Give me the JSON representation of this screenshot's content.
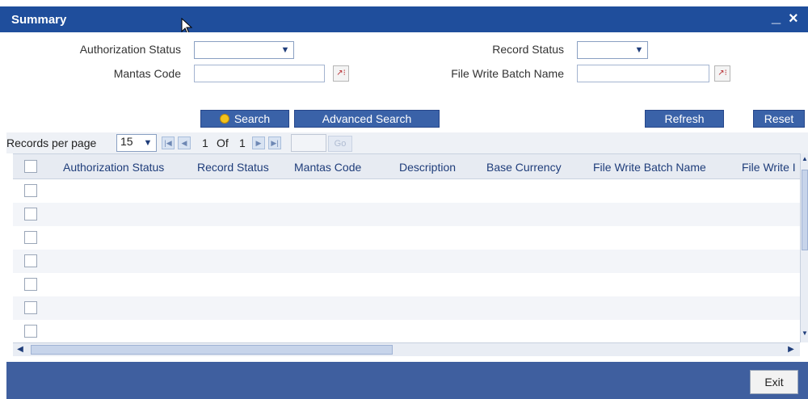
{
  "window": {
    "title": "Summary",
    "minimize_glyph": "_",
    "close_glyph": "×"
  },
  "filters": {
    "authorization_status_label": "Authorization Status",
    "record_status_label": "Record Status",
    "mantas_code_label": "Mantas Code",
    "file_write_batch_name_label": "File Write Batch Name",
    "authorization_status_value": "",
    "record_status_value": "",
    "mantas_code_value": "",
    "file_write_batch_name_value": ""
  },
  "buttons": {
    "search": "Search",
    "advanced_search": "Advanced Search",
    "refresh": "Refresh",
    "reset": "Reset",
    "exit": "Exit",
    "go": "Go"
  },
  "pagination": {
    "records_per_page_label": "Records per page",
    "records_per_page_value": "15",
    "current_page": "1",
    "of_label": "Of",
    "total_pages": "1"
  },
  "grid": {
    "columns": [
      "Authorization Status",
      "Record Status",
      "Mantas Code",
      "Description",
      "Base Currency",
      "File Write Batch Name",
      "File Write I"
    ],
    "rows": [
      {
        "selected": false
      },
      {
        "selected": false
      },
      {
        "selected": false
      },
      {
        "selected": false
      },
      {
        "selected": false
      },
      {
        "selected": false
      },
      {
        "selected": false
      }
    ]
  },
  "colors": {
    "titlebar": "#1f4e9c",
    "button": "#3a62a8",
    "footer": "#3f5f9f"
  },
  "icons": {
    "search": "search-icon",
    "lov": "lov-icon",
    "dropdown": "chevron-down-icon"
  }
}
